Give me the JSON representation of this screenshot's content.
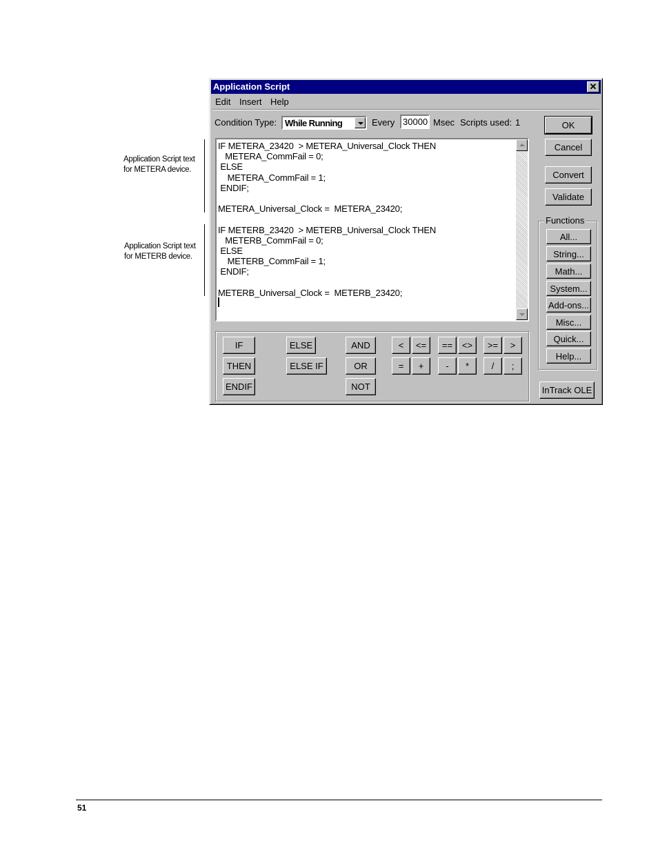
{
  "annotations": {
    "metera_line1": "Application Script text",
    "metera_line2": "for METERA device.",
    "meterb_line1": "Application Script text",
    "meterb_line2": "for METERB device."
  },
  "window": {
    "title": "Application Script",
    "close_glyph": "✕",
    "menu": {
      "edit": "Edit",
      "insert": "Insert",
      "help": "Help"
    },
    "condition_label": "Condition Type:",
    "condition_value": "While Running",
    "every_label": "Every",
    "every_value": "30000",
    "msec_label": "Msec",
    "scripts_used_label": "Scripts used:",
    "scripts_used_value": "1",
    "script_text": "IF METERA_23420  > METERA_Universal_Clock THEN\n   METERA_CommFail = 0;\n ELSE\n    METERA_CommFail = 1;\n ENDIF;\n\nMETERA_Universal_Clock =  METERA_23420;\n\nIF METERB_23420  > METERB_Universal_Clock THEN\n   METERB_CommFail = 0;\n ELSE\n    METERB_CommFail = 1;\n ENDIF;\n\nMETERB_Universal_Clock =  METERB_23420;",
    "keypad": {
      "if": "IF",
      "then": "THEN",
      "endif": "ENDIF",
      "else": "ELSE",
      "elseif": "ELSE IF",
      "and": "AND",
      "or": "OR",
      "not": "NOT",
      "lt": "<",
      "le": "<=",
      "eq": "==",
      "ne": "<>",
      "ge": ">=",
      "gt": ">",
      "assign": "=",
      "plus": "+",
      "minus": "-",
      "mul": "*",
      "div": "/",
      "semi": ";"
    },
    "side_buttons": {
      "ok": "OK",
      "cancel": "Cancel",
      "convert": "Convert",
      "validate": "Validate",
      "functions_title": "Functions",
      "all": "All...",
      "string": "String...",
      "math": "Math...",
      "system": "System...",
      "addons": "Add-ons...",
      "misc": "Misc...",
      "quick": "Quick...",
      "help": "Help...",
      "intrack": "InTrack OLE"
    }
  },
  "page_number": "51"
}
